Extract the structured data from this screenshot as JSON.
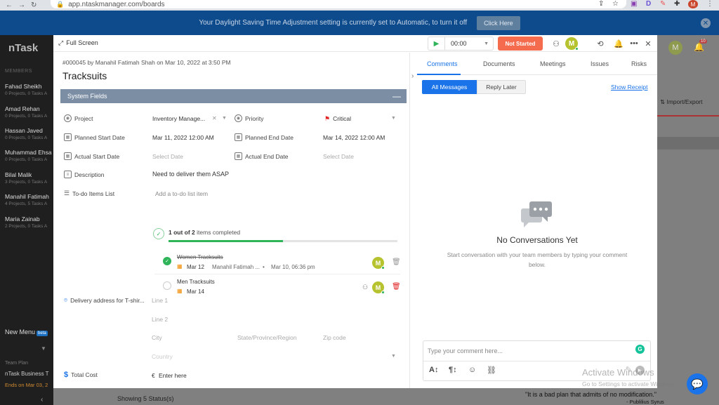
{
  "browser": {
    "url": "app.ntaskmanager.com/boards",
    "profile_initial": "M"
  },
  "banner": {
    "text": "Your Daylight Saving Time Adjustment setting is currently set to Automatic, to turn it off",
    "button": "Click Here"
  },
  "background_app": {
    "logo": "nTask",
    "members_heading": "MEMBERS",
    "members": [
      {
        "name": "Fahad Sheikh",
        "sub": "0 Projects, 0 Tasks A"
      },
      {
        "name": "Amad Rehan",
        "sub": "0 Projects, 0 Tasks A"
      },
      {
        "name": "Hassan Javed",
        "sub": "0 Projects, 0 Tasks A"
      },
      {
        "name": "Muhammad Ehsa",
        "sub": "0 Projects, 0 Tasks A"
      },
      {
        "name": "Bilal Malik",
        "sub": "3 Projects, 0 Tasks A"
      },
      {
        "name": "Manahil Fatimah",
        "sub": "4 Projects, 5 Tasks A"
      },
      {
        "name": "Maria Zainab",
        "sub": "2 Projects, 0 Tasks A"
      }
    ],
    "new_menu": "New Menu",
    "beta": "beta",
    "team_plan_label": "Team Plan",
    "plan_name": "nTask Business T",
    "plan_ends": "Ends on Mar 03, 2",
    "import_export": "Import/Export",
    "notif_count": "10",
    "bottom_status": "Showing 5 Status(s)",
    "quote": "\"It is a bad plan that admits of no modification.\"",
    "quote_author": "- Publilius Syrus",
    "watermark_title": "Activate Windows",
    "watermark_sub": "Go to Settings to activate Windows."
  },
  "modal": {
    "full_screen": "Full Screen",
    "timer": "00:00",
    "status": "Not Started",
    "user_initial": "M",
    "meta": "#000045 by Manahil Fatimah Shah on Mar 10, 2022 at 3:50 PM",
    "title": "Tracksuits",
    "section": "System Fields",
    "fields": {
      "project_label": "Project",
      "project_value": "Inventory Manage...",
      "priority_label": "Priority",
      "priority_value": "Critical",
      "planned_start_label": "Planned Start Date",
      "planned_start_value": "Mar 11, 2022 12:00 AM",
      "planned_end_label": "Planned End Date",
      "planned_end_value": "Mar 14, 2022 12:00 AM",
      "actual_start_label": "Actual Start Date",
      "actual_start_placeholder": "Select Date",
      "actual_end_label": "Actual End Date",
      "actual_end_placeholder": "Select Date",
      "description_label": "Description",
      "description_value": "Need to deliver them ASAP",
      "todo_label": "To-do Items List",
      "todo_placeholder": "Add a to-do list item",
      "progress_bold": "1 out of 2",
      "progress_rest": "items completed",
      "progress_fraction": 0.5,
      "delivery_label": "Delivery address for T-shir...",
      "line1": "Line 1",
      "line2": "Line 2",
      "city": "City",
      "state": "State/Province/Region",
      "zip": "Zip code",
      "country": "Country",
      "total_cost_label": "Total Cost",
      "currency": "€",
      "total_cost_placeholder": "Enter here"
    },
    "todos": [
      {
        "name": "Women Tracksuits",
        "date": "Mar 12",
        "by": "Manahil Fatimah ...",
        "when": "Mar 10, 06:36 pm",
        "done": true,
        "avatar": "M"
      },
      {
        "name": "Men Tracksuits",
        "date": "Mar 14",
        "done": false,
        "avatar": "M"
      }
    ],
    "tabs": [
      "Comments",
      "Documents",
      "Meetings",
      "Issues",
      "Risks"
    ],
    "seg_all": "All Messages",
    "seg_later": "Reply Later",
    "show_receipt": "Show Receipt",
    "empty_title": "No Conversations Yet",
    "empty_sub": "Start conversation with your team members by typing your comment below.",
    "comment_placeholder": "Type your comment here...",
    "grammarly": "G"
  },
  "colors": {
    "accent": "#1a73e8",
    "status": "#f56b4d",
    "banner": "#0e4b8d",
    "success": "#2fb459",
    "critical": "#e02424"
  }
}
